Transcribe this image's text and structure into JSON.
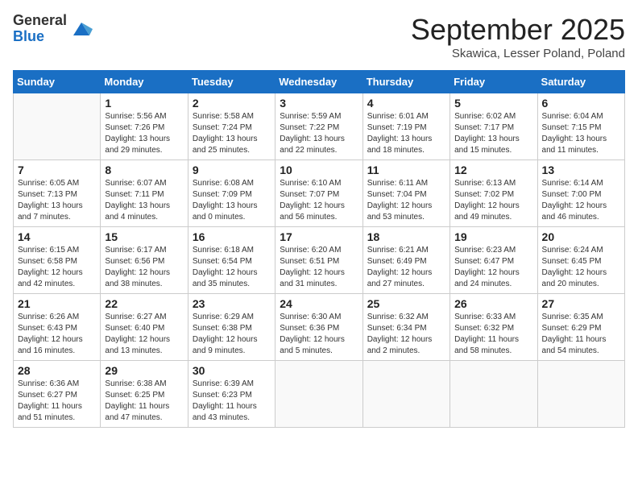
{
  "logo": {
    "general": "General",
    "blue": "Blue"
  },
  "header": {
    "title": "September 2025",
    "location": "Skawica, Lesser Poland, Poland"
  },
  "days_of_week": [
    "Sunday",
    "Monday",
    "Tuesday",
    "Wednesday",
    "Thursday",
    "Friday",
    "Saturday"
  ],
  "weeks": [
    [
      {
        "day": "",
        "info": ""
      },
      {
        "day": "1",
        "info": "Sunrise: 5:56 AM\nSunset: 7:26 PM\nDaylight: 13 hours\nand 29 minutes."
      },
      {
        "day": "2",
        "info": "Sunrise: 5:58 AM\nSunset: 7:24 PM\nDaylight: 13 hours\nand 25 minutes."
      },
      {
        "day": "3",
        "info": "Sunrise: 5:59 AM\nSunset: 7:22 PM\nDaylight: 13 hours\nand 22 minutes."
      },
      {
        "day": "4",
        "info": "Sunrise: 6:01 AM\nSunset: 7:19 PM\nDaylight: 13 hours\nand 18 minutes."
      },
      {
        "day": "5",
        "info": "Sunrise: 6:02 AM\nSunset: 7:17 PM\nDaylight: 13 hours\nand 15 minutes."
      },
      {
        "day": "6",
        "info": "Sunrise: 6:04 AM\nSunset: 7:15 PM\nDaylight: 13 hours\nand 11 minutes."
      }
    ],
    [
      {
        "day": "7",
        "info": "Sunrise: 6:05 AM\nSunset: 7:13 PM\nDaylight: 13 hours\nand 7 minutes."
      },
      {
        "day": "8",
        "info": "Sunrise: 6:07 AM\nSunset: 7:11 PM\nDaylight: 13 hours\nand 4 minutes."
      },
      {
        "day": "9",
        "info": "Sunrise: 6:08 AM\nSunset: 7:09 PM\nDaylight: 13 hours\nand 0 minutes."
      },
      {
        "day": "10",
        "info": "Sunrise: 6:10 AM\nSunset: 7:07 PM\nDaylight: 12 hours\nand 56 minutes."
      },
      {
        "day": "11",
        "info": "Sunrise: 6:11 AM\nSunset: 7:04 PM\nDaylight: 12 hours\nand 53 minutes."
      },
      {
        "day": "12",
        "info": "Sunrise: 6:13 AM\nSunset: 7:02 PM\nDaylight: 12 hours\nand 49 minutes."
      },
      {
        "day": "13",
        "info": "Sunrise: 6:14 AM\nSunset: 7:00 PM\nDaylight: 12 hours\nand 46 minutes."
      }
    ],
    [
      {
        "day": "14",
        "info": "Sunrise: 6:15 AM\nSunset: 6:58 PM\nDaylight: 12 hours\nand 42 minutes."
      },
      {
        "day": "15",
        "info": "Sunrise: 6:17 AM\nSunset: 6:56 PM\nDaylight: 12 hours\nand 38 minutes."
      },
      {
        "day": "16",
        "info": "Sunrise: 6:18 AM\nSunset: 6:54 PM\nDaylight: 12 hours\nand 35 minutes."
      },
      {
        "day": "17",
        "info": "Sunrise: 6:20 AM\nSunset: 6:51 PM\nDaylight: 12 hours\nand 31 minutes."
      },
      {
        "day": "18",
        "info": "Sunrise: 6:21 AM\nSunset: 6:49 PM\nDaylight: 12 hours\nand 27 minutes."
      },
      {
        "day": "19",
        "info": "Sunrise: 6:23 AM\nSunset: 6:47 PM\nDaylight: 12 hours\nand 24 minutes."
      },
      {
        "day": "20",
        "info": "Sunrise: 6:24 AM\nSunset: 6:45 PM\nDaylight: 12 hours\nand 20 minutes."
      }
    ],
    [
      {
        "day": "21",
        "info": "Sunrise: 6:26 AM\nSunset: 6:43 PM\nDaylight: 12 hours\nand 16 minutes."
      },
      {
        "day": "22",
        "info": "Sunrise: 6:27 AM\nSunset: 6:40 PM\nDaylight: 12 hours\nand 13 minutes."
      },
      {
        "day": "23",
        "info": "Sunrise: 6:29 AM\nSunset: 6:38 PM\nDaylight: 12 hours\nand 9 minutes."
      },
      {
        "day": "24",
        "info": "Sunrise: 6:30 AM\nSunset: 6:36 PM\nDaylight: 12 hours\nand 5 minutes."
      },
      {
        "day": "25",
        "info": "Sunrise: 6:32 AM\nSunset: 6:34 PM\nDaylight: 12 hours\nand 2 minutes."
      },
      {
        "day": "26",
        "info": "Sunrise: 6:33 AM\nSunset: 6:32 PM\nDaylight: 11 hours\nand 58 minutes."
      },
      {
        "day": "27",
        "info": "Sunrise: 6:35 AM\nSunset: 6:29 PM\nDaylight: 11 hours\nand 54 minutes."
      }
    ],
    [
      {
        "day": "28",
        "info": "Sunrise: 6:36 AM\nSunset: 6:27 PM\nDaylight: 11 hours\nand 51 minutes."
      },
      {
        "day": "29",
        "info": "Sunrise: 6:38 AM\nSunset: 6:25 PM\nDaylight: 11 hours\nand 47 minutes."
      },
      {
        "day": "30",
        "info": "Sunrise: 6:39 AM\nSunset: 6:23 PM\nDaylight: 11 hours\nand 43 minutes."
      },
      {
        "day": "",
        "info": ""
      },
      {
        "day": "",
        "info": ""
      },
      {
        "day": "",
        "info": ""
      },
      {
        "day": "",
        "info": ""
      }
    ]
  ]
}
